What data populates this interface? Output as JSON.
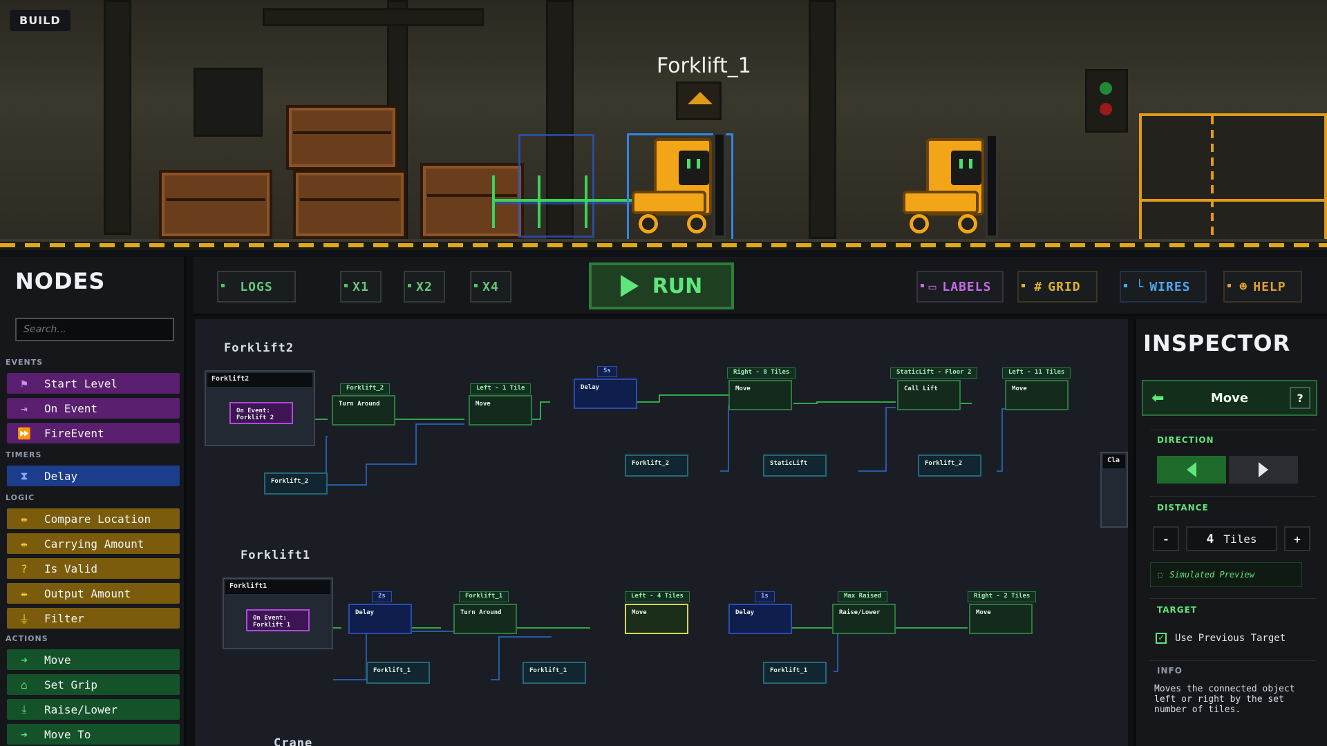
{
  "mode_badge": "BUILD",
  "scene": {
    "selected_robot": "Forklift_1"
  },
  "toolbar": {
    "logs": "LOGS",
    "speed1": "X1",
    "speed2": "X2",
    "speed4": "X4",
    "run": "RUN",
    "labels": "LABELS",
    "grid": "GRID",
    "wires": "WIRES",
    "help": "HELP"
  },
  "sidebar": {
    "title": "NODES",
    "search_placeholder": "Search...",
    "categories": {
      "events": "EVENTS",
      "timers": "TIMERS",
      "logic": "LOGIC",
      "actions": "ACTIONS"
    },
    "events": [
      "Start Level",
      "On Event",
      "FireEvent"
    ],
    "timers": [
      "Delay"
    ],
    "logic": [
      "Compare Location",
      "Carrying Amount",
      "Is Valid",
      "Output Amount",
      "Filter"
    ],
    "actions": [
      "Move",
      "Set Grip",
      "Raise/Lower",
      "Move To"
    ]
  },
  "graph": {
    "group_forklift2": {
      "name": "Forklift2",
      "panel": "Forklift2",
      "event": "On Event: Forklift 2",
      "nodes": [
        "Turn Around",
        "Move",
        "Delay",
        "Move",
        "Call Lift",
        "Move"
      ],
      "tags": [
        "Forklift_2",
        "Left - 1 Tile",
        "5s",
        "Right - 8 Tiles",
        "StaticLift - Floor 2",
        "Left - 11 Tiles"
      ],
      "refs": [
        "Forklift_2",
        "Forklift_2",
        "StaticLift",
        "Forklift_2"
      ]
    },
    "group_forklift1": {
      "name": "Forklift1",
      "panel": "Forklift1",
      "event": "On Event: Forklift 1",
      "nodes": [
        "Delay",
        "Turn Around",
        "Move",
        "Delay",
        "Raise/Lower",
        "Move"
      ],
      "tags": [
        "2s",
        "Forklift_1",
        "Left - 4 Tiles",
        "1s",
        "Max Raised",
        "Right - 2 Tiles"
      ],
      "refs": [
        "Forklift_1",
        "Forklift_1",
        "Forklift_1"
      ]
    },
    "group_crane": {
      "name": "Crane"
    },
    "partial_panel": "Cla"
  },
  "inspector": {
    "title": "INSPECTOR",
    "node": "Move",
    "help": "?",
    "direction_label": "DIRECTION",
    "distance_label": "DISTANCE",
    "distance_minus": "-",
    "distance_plus": "+",
    "distance_value": "4",
    "distance_unit": "Tiles",
    "simulated_preview": "Simulated Preview",
    "target_label": "TARGET",
    "use_previous_target": "Use Previous Target",
    "info_label": "INFO",
    "info_text": "Moves the connected object left or right by the set number of tiles."
  },
  "colors": {
    "event": "#5a1f6e",
    "timer": "#1c3c8c",
    "logic": "#7a5c0c",
    "action": "#14532a",
    "accent": "#5fe67a"
  }
}
